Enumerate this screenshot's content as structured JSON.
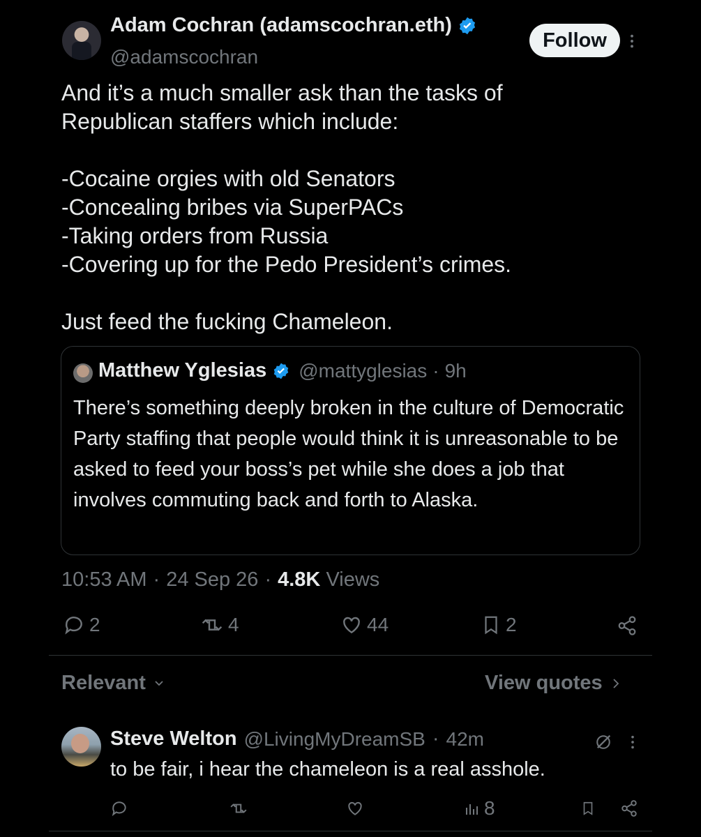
{
  "tweet": {
    "author_name": "Adam Cochran (adamscochran.eth)",
    "author_handle": "@adamscochran",
    "follow_label": "Follow",
    "body": "And it’s a much smaller ask than the tasks of\nRepublican staffers which include:\n\n-Cocaine orgies with old Senators\n-Concealing bribes via SuperPACs\n-Taking orders from Russia\n-Covering up for the Pedo President’s crimes.\n\nJust feed the fucking Chameleon.",
    "time": "10:53 AM",
    "date": "24 Sep 26",
    "views_count": "4.8K",
    "views_label": "Views",
    "replies": "2",
    "retweets": "4",
    "likes": "44",
    "bookmarks": "2"
  },
  "quote": {
    "author_name": "Matthew Yglesias",
    "author_handle": "@mattyglesias",
    "time": "9h",
    "text": "There’s something deeply broken in the culture of Democratic Party staffing that people would think it is unreasonable to be asked to feed your boss’s pet while she does a job that involves commuting back and forth to Alaska."
  },
  "replies_header": {
    "sort_label": "Relevant",
    "view_quotes_label": "View quotes"
  },
  "reply": {
    "author_name": "Steve Welton",
    "author_handle": "@LivingMyDreamSB",
    "time": "42m",
    "text": "to be fair, i hear the chameleon is a real asshole.",
    "views": "8"
  },
  "colors": {
    "background": "#000000",
    "text": "#e7e9ea",
    "muted": "#71767b",
    "verified": "#1d9bf0",
    "border": "#2f3336"
  }
}
